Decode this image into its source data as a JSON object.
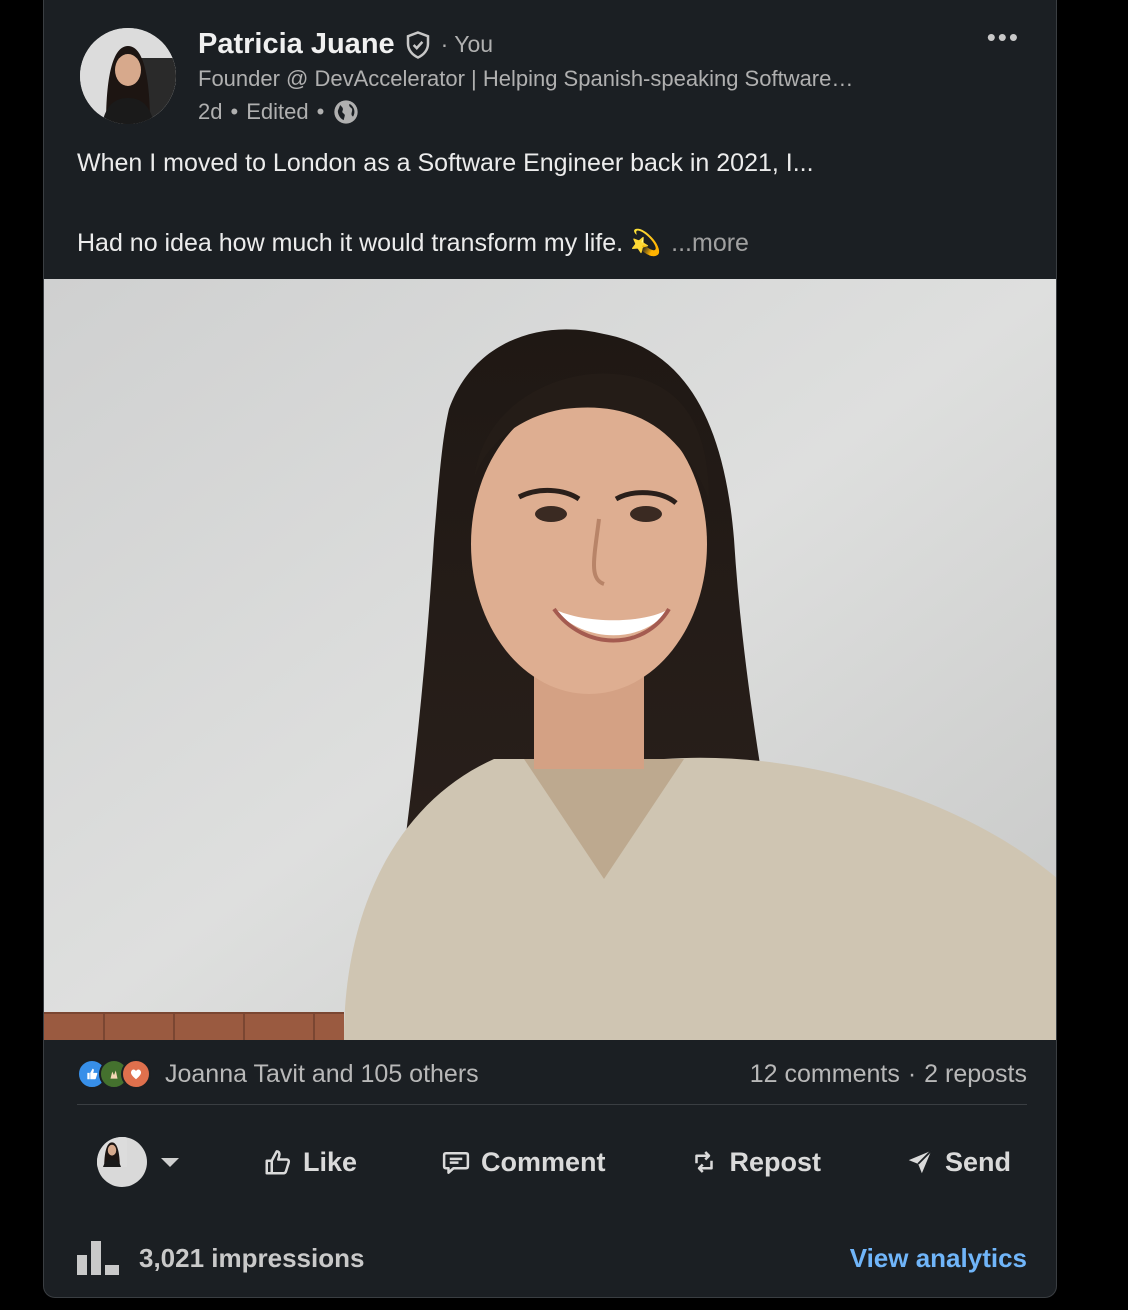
{
  "author": {
    "name": "Patricia Juane",
    "relation": "· You",
    "headline": "Founder @ DevAccelerator | Helping Spanish-speaking Software…",
    "age": "2d",
    "edited": "Edited",
    "separator": "•"
  },
  "menu": {
    "label": "•••"
  },
  "post": {
    "line1": "When I moved to London as a Software Engineer back in 2021, I...",
    "line2": "Had no idea how much it would transform my life. 💫",
    "see_more": "...more"
  },
  "social": {
    "reactors": "Joanna Tavit and 105 others",
    "comments": "12 comments",
    "dot": "·",
    "reposts": "2 reposts"
  },
  "actions": {
    "like": "Like",
    "comment": "Comment",
    "repost": "Repost",
    "send": "Send"
  },
  "footer": {
    "impressions": "3,021 impressions",
    "analytics": "View analytics"
  },
  "colors": {
    "background": "#1b1f23",
    "accent_link": "#70b5f9",
    "like_blue": "#378fe9",
    "celebrate_green": "#44712e",
    "love_red": "#df704d"
  }
}
